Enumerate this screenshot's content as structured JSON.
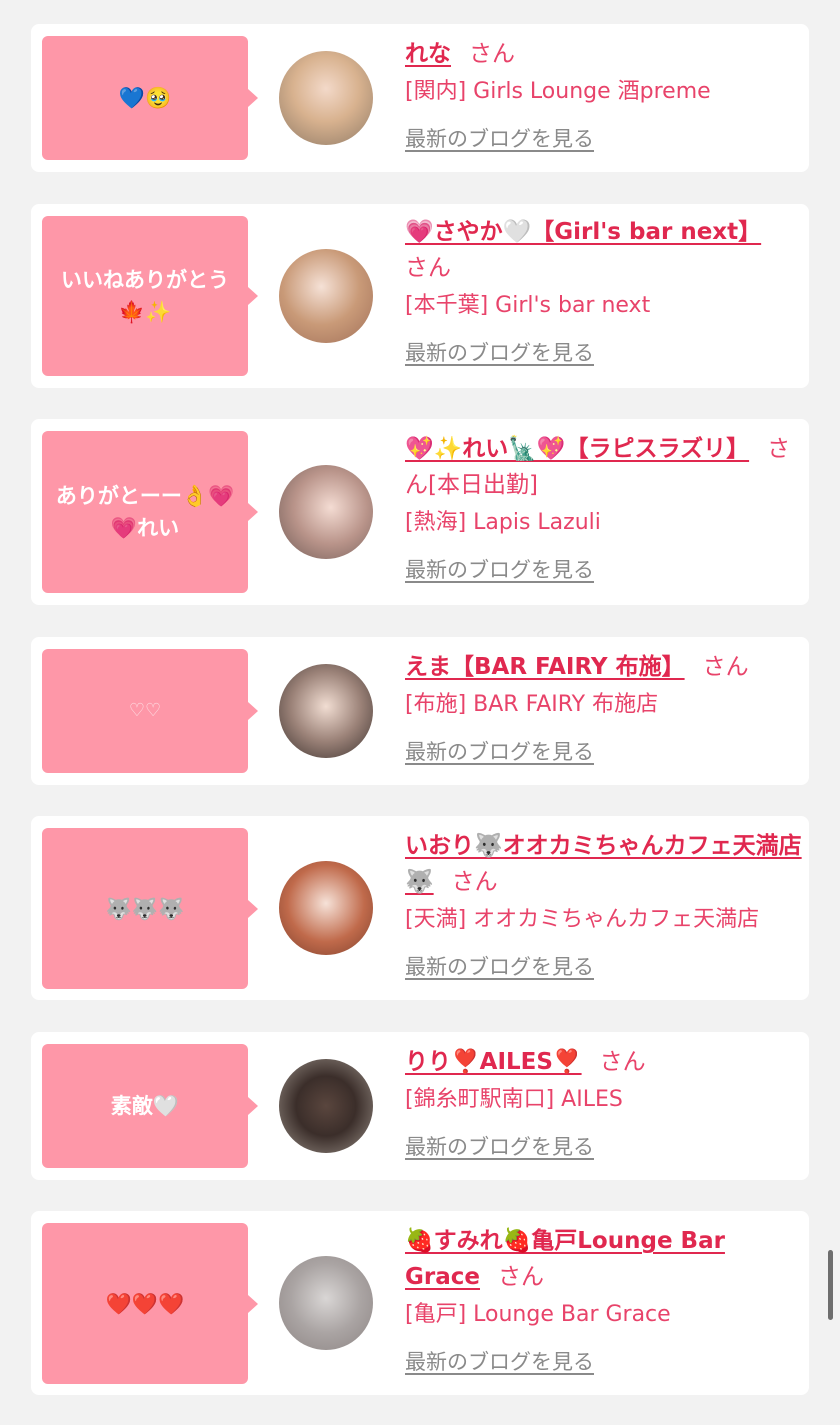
{
  "colors": {
    "page_background": "#f2f2f2",
    "bubble": "#fe97a8",
    "name_link": "#e0284f",
    "shop_text": "#e8436a",
    "blog_link": "#8a8a8a"
  },
  "san_label": "さん",
  "blog_link_label": "最新のブログを見る",
  "cards": [
    {
      "comment": "💙🥹",
      "name": "れな",
      "suffix": "",
      "shop": "[関内] Girls Lounge 酒preme"
    },
    {
      "comment": "いいねありがとう🍁✨",
      "name": "💗さやか🤍【Girl's bar next】",
      "suffix": "",
      "shop": "[本千葉] Girl's bar next"
    },
    {
      "comment": "ありがとーー👌💗💗れい",
      "name": "💖✨れい🗽💖【ラピスラズリ】",
      "suffix": "[本日出勤]",
      "shop": "[熱海] Lapis Lazuli"
    },
    {
      "comment": "♡♡",
      "name": "えま【BAR FAIRY 布施】",
      "suffix": "",
      "shop": "[布施] BAR FAIRY 布施店"
    },
    {
      "comment": "🐺🐺🐺",
      "name": "いおり🐺オオカミちゃんカフェ天満店🐺",
      "suffix": "",
      "shop": "[天満] オオカミちゃんカフェ天満店"
    },
    {
      "comment": "素敵🤍",
      "name": "りり❣️AILES❣️",
      "suffix": "",
      "shop": "[錦糸町駅南口] AILES"
    },
    {
      "comment": "❤️❤️❤️",
      "name": "🍓すみれ🍓亀戸Lounge Bar Grace",
      "suffix": "",
      "shop": "[亀戸] Lounge Bar Grace"
    }
  ]
}
